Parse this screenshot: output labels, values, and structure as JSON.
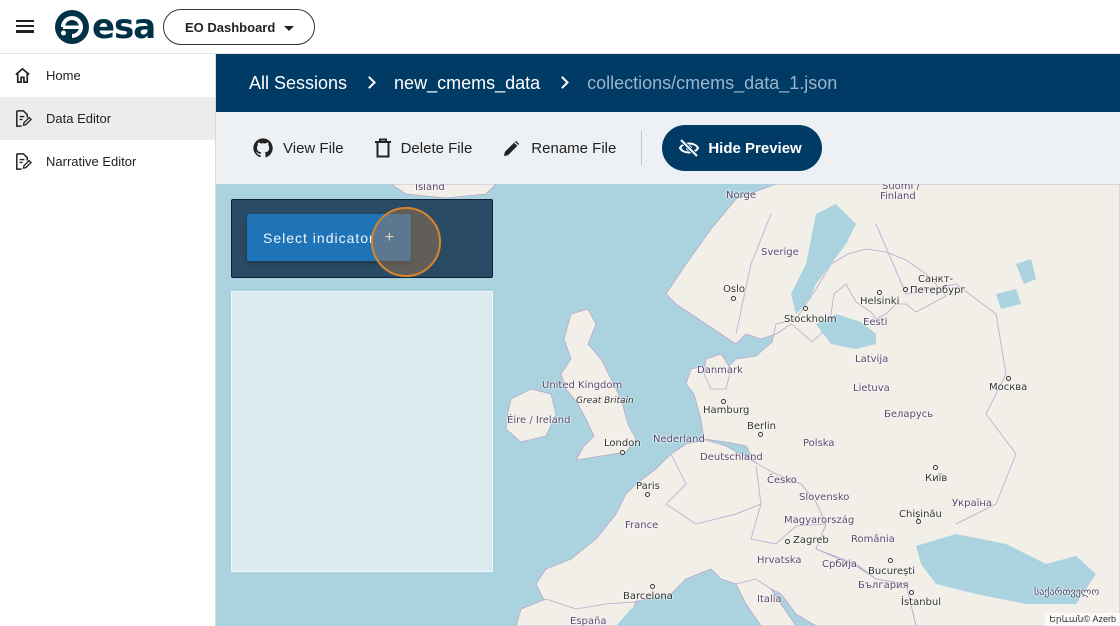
{
  "topbar": {
    "logo_text": "esa",
    "dashboard_selector": "EO Dashboard"
  },
  "sidebar": {
    "items": [
      {
        "label": "Home",
        "icon": "home-icon",
        "active": false
      },
      {
        "label": "Data Editor",
        "icon": "edit-document-icon",
        "active": true
      },
      {
        "label": "Narrative Editor",
        "icon": "edit-document-icon",
        "active": false
      }
    ]
  },
  "breadcrumb": {
    "items": [
      "All Sessions",
      "new_cmems_data",
      "collections/cmems_data_1.json"
    ]
  },
  "toolbar": {
    "view_file": "View File",
    "delete_file": "Delete File",
    "rename_file": "Rename File",
    "hide_preview": "Hide Preview"
  },
  "map": {
    "select_indicator": "Select indicator",
    "select_plus": "+",
    "attribution": "Երևան© Azerb",
    "places": [
      {
        "label": "Island",
        "type": "country"
      },
      {
        "label": "Norge",
        "type": "country"
      },
      {
        "label": "Suomi /",
        "type": "country"
      },
      {
        "label": "Finland",
        "type": "country"
      },
      {
        "label": "Sverige",
        "type": "country"
      },
      {
        "label": "Oslo",
        "type": "city"
      },
      {
        "label": "Helsinki",
        "type": "city"
      },
      {
        "label": "Санкт-",
        "type": "city"
      },
      {
        "label": "Петербург",
        "type": "city"
      },
      {
        "label": "Stockholm",
        "type": "city"
      },
      {
        "label": "Eesti",
        "type": "country"
      },
      {
        "label": "Latvija",
        "type": "country"
      },
      {
        "label": "Danmark",
        "type": "country"
      },
      {
        "label": "Lietuva",
        "type": "country"
      },
      {
        "label": "Москва",
        "type": "city"
      },
      {
        "label": "United Kingdom",
        "type": "country"
      },
      {
        "label": "Great Britain",
        "type": "island"
      },
      {
        "label": "Éire / Ireland",
        "type": "country"
      },
      {
        "label": "Hamburg",
        "type": "city"
      },
      {
        "label": "Беларусь",
        "type": "country"
      },
      {
        "label": "Berlin",
        "type": "city"
      },
      {
        "label": "London",
        "type": "city"
      },
      {
        "label": "Nederland",
        "type": "country"
      },
      {
        "label": "Polska",
        "type": "country"
      },
      {
        "label": "Deutschland",
        "type": "country"
      },
      {
        "label": "Київ",
        "type": "city"
      },
      {
        "label": "Česko",
        "type": "country"
      },
      {
        "label": "Paris",
        "type": "city"
      },
      {
        "label": "Slovensko",
        "type": "country"
      },
      {
        "label": "Україна",
        "type": "country"
      },
      {
        "label": "Chișinău",
        "type": "city"
      },
      {
        "label": "France",
        "type": "country"
      },
      {
        "label": "Magyarország",
        "type": "country"
      },
      {
        "label": "Zagreb",
        "type": "city"
      },
      {
        "label": "România",
        "type": "country"
      },
      {
        "label": "Hrvatska",
        "type": "country"
      },
      {
        "label": "Србија",
        "type": "country"
      },
      {
        "label": "București",
        "type": "city"
      },
      {
        "label": "България",
        "type": "country"
      },
      {
        "label": "Barcelona",
        "type": "city"
      },
      {
        "label": "Italia",
        "type": "country"
      },
      {
        "label": "İstanbul",
        "type": "city"
      },
      {
        "label": "საქართველო",
        "type": "country"
      },
      {
        "label": "España",
        "type": "country"
      }
    ]
  },
  "colors": {
    "header": "#003b66",
    "toolbar": "#eef1f4",
    "water": "#aad3df",
    "land": "#f2efe9",
    "select_button": "#1f73b7"
  }
}
